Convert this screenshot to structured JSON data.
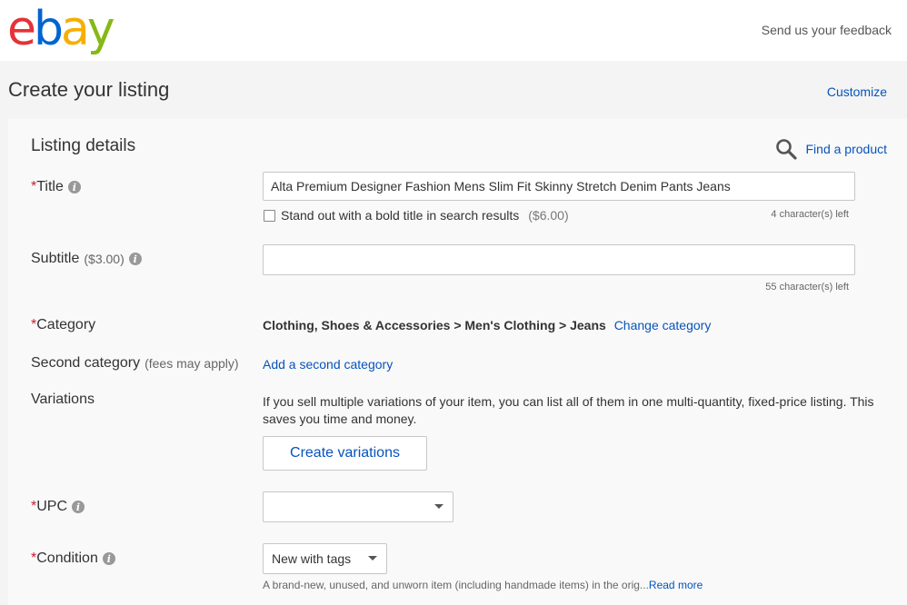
{
  "header": {
    "logo": "ebay",
    "feedback_link": "Send us your feedback"
  },
  "page": {
    "title": "Create your listing",
    "customize_link": "Customize"
  },
  "listing_details": {
    "section_title": "Listing details",
    "find_product": "Find a product",
    "title_field": {
      "required_mark": "*",
      "label": "Title",
      "value": "Alta Premium Designer Fashion Mens Slim Fit Skinny Stretch Denim Pants Jeans",
      "bold_option": "Stand out with a bold title in search results",
      "bold_price": "($6.00)",
      "chars_left": "4 character(s) left"
    },
    "subtitle_field": {
      "label": "Subtitle",
      "fee": "($3.00)",
      "value": "",
      "chars_left": "55 character(s) left"
    },
    "category": {
      "required_mark": "*",
      "label": "Category",
      "path": "Clothing, Shoes & Accessories > Men's Clothing > Jeans",
      "change_link": "Change category"
    },
    "second_category": {
      "label": "Second category",
      "fee": "(fees may apply)",
      "add_link": "Add a second category"
    },
    "variations": {
      "label": "Variations",
      "description": "If you sell multiple variations of your item, you can list all of them in one multi-quantity, fixed-price listing. This saves you time and money.",
      "button": "Create variations"
    },
    "upc": {
      "required_mark": "*",
      "label": "UPC",
      "value": ""
    },
    "condition": {
      "required_mark": "*",
      "label": "Condition",
      "value": "New with tags",
      "description": "A brand-new, unused, and unworn item (including handmade items) in the orig...",
      "read_more": "Read more"
    }
  },
  "colors": {
    "link": "#0654ba",
    "required": "#c8202f",
    "logo_e": "#e53238",
    "logo_b": "#0064d2",
    "logo_a": "#f5af02",
    "logo_y": "#86b817"
  },
  "icons": {
    "info": "info-icon",
    "search": "search-icon",
    "dropdown": "chevron-down-icon"
  }
}
